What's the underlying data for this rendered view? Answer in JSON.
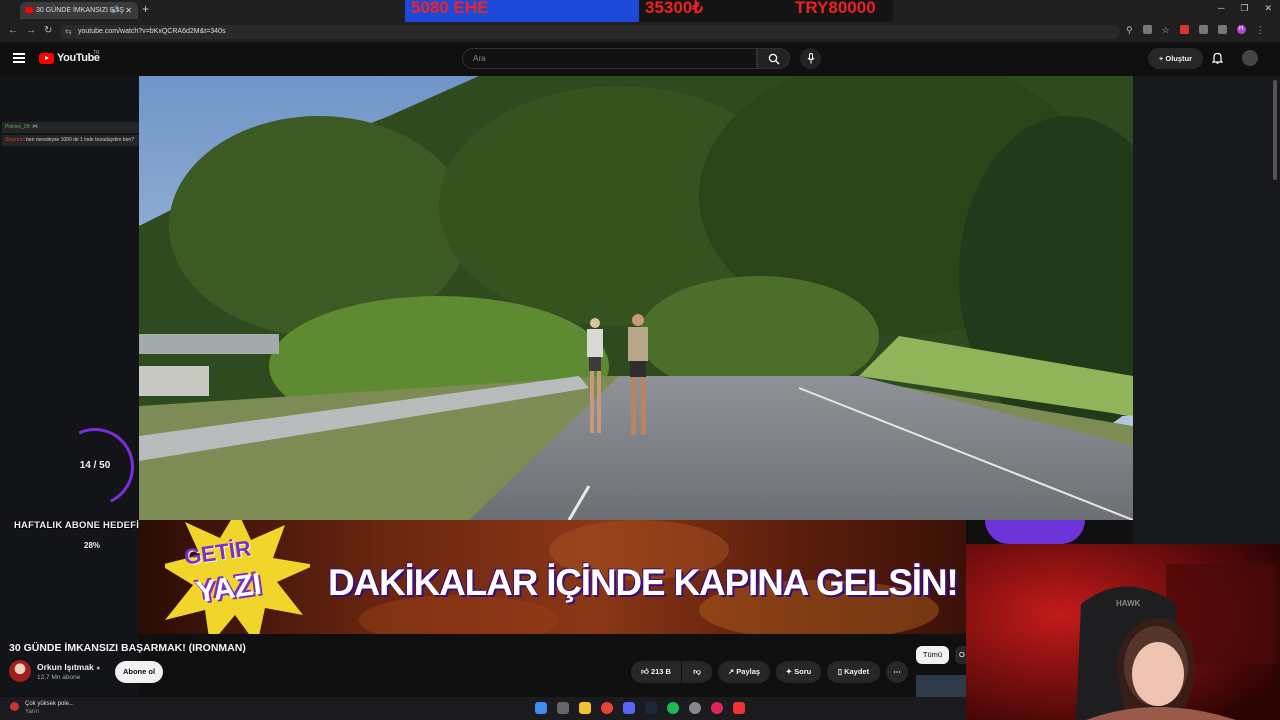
{
  "browser": {
    "tab_title": "30 GÜNDE İMKANSIZI BAŞ",
    "new_tab_label": "+",
    "url": "youtube.com/watch?v=bKxQCRA6d2M&t=340s"
  },
  "stream_overlay": {
    "item1": "5080 EHE",
    "item2": "35300₺",
    "item3": "TRY80000"
  },
  "youtube": {
    "logo_text": "YouTube",
    "country_code": "TR",
    "search_placeholder": "Ara",
    "create_label": "Oluştur"
  },
  "chat_messages": [
    {
      "user": "Pinkies_09",
      "text": "🎮"
    },
    {
      "user": "Stayretc",
      "text": "ben neredeyse 1000 de 1 inde buradaydım ben?"
    }
  ],
  "goal_widget": {
    "count_text": "14 / 50",
    "title": "HAFTALIK ABONE HEDEFİ",
    "percent_text": "28%",
    "progress": 0.28
  },
  "banner": {
    "brand_line1": "GETİR",
    "brand_line2": "YAZI",
    "headline": "DAKİKALAR İÇİNDE KAPINA GELSİN!"
  },
  "video": {
    "title": "30 GÜNDE İMKANSIZI BAŞARMAK! (IRONMAN)",
    "channel_name": "Orkun Işıtmak",
    "channel_subs": "12,7 Mn abone",
    "subscribe_label": "Abone ol",
    "likes": "213 B",
    "share_label": "Paylaş",
    "ask_label": "Soru",
    "save_label": "Kaydet"
  },
  "sidebar_chips": {
    "all_label": "Tümü",
    "next_label": "O"
  },
  "taskbar": {
    "notification_title": "Çok yüksek pole...",
    "notification_sub": "Yarın"
  },
  "colors": {
    "youtube_red": "#ff0000",
    "goal_purple": "#7b2fdb",
    "overlay_blue": "#1c49d8"
  }
}
